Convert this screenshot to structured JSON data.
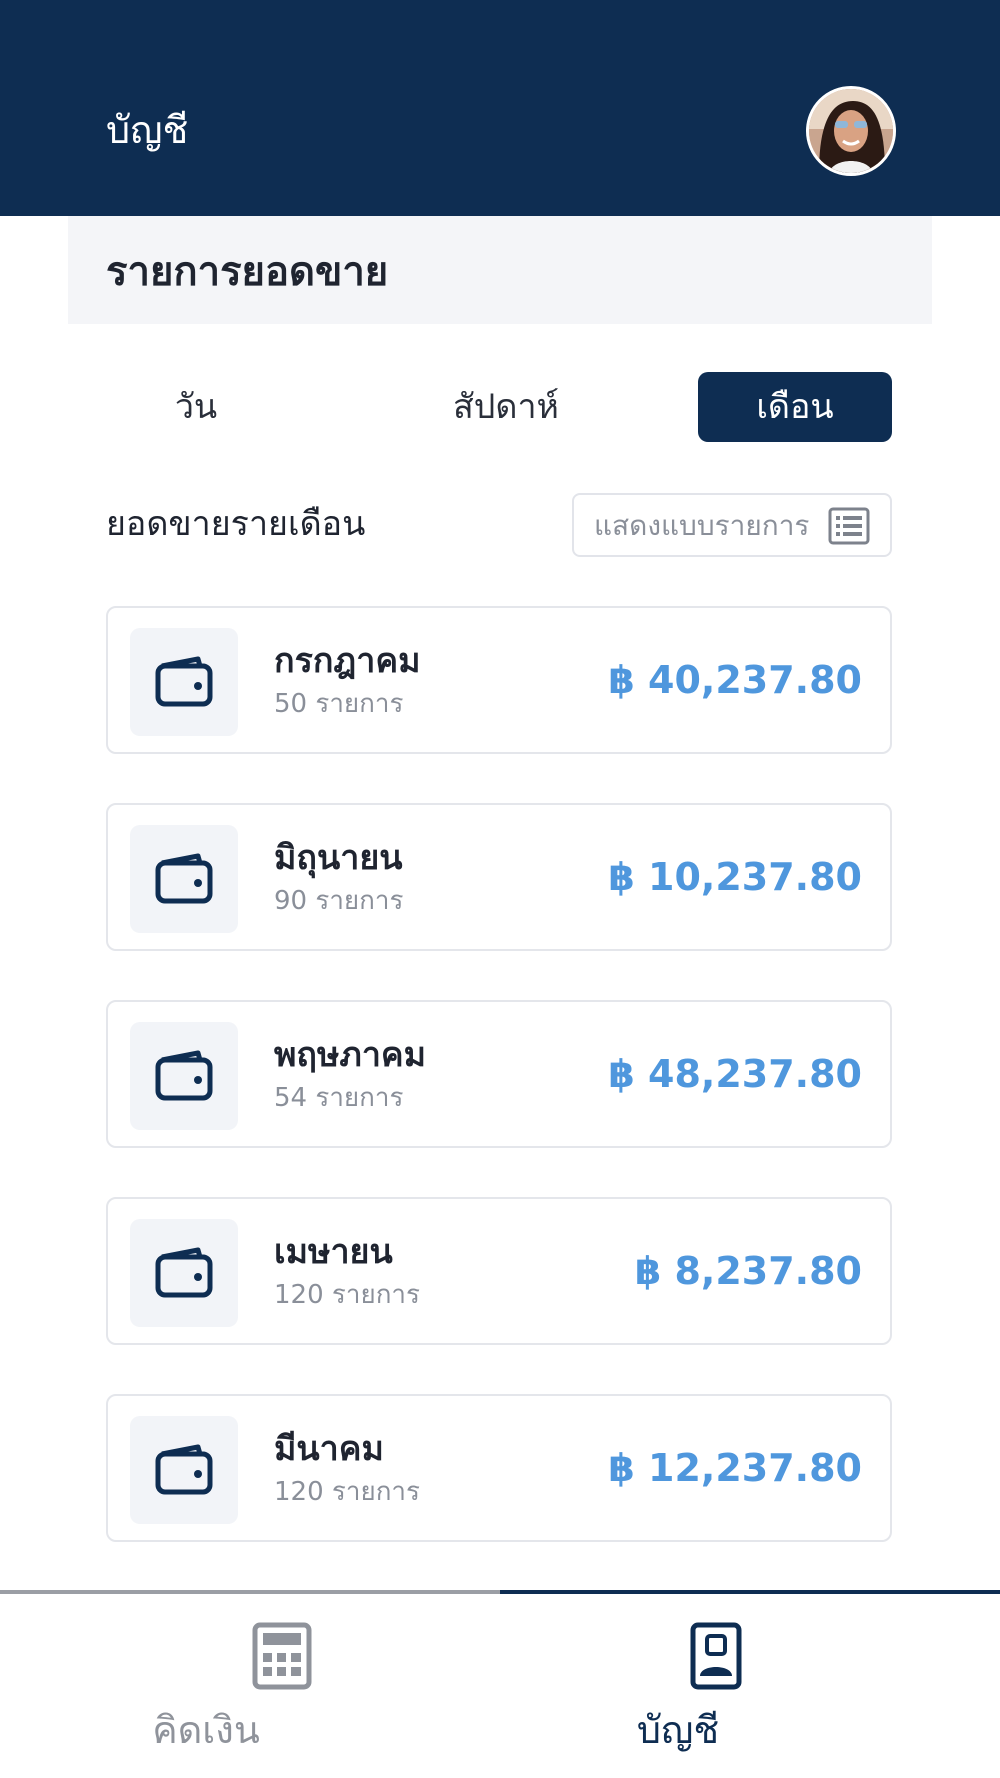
{
  "header": {
    "title": "บัญชี"
  },
  "section": {
    "title": "รายการยอดขาย"
  },
  "tabs": [
    {
      "label": "วัน",
      "active": false
    },
    {
      "label": "สัปดาห์",
      "active": false
    },
    {
      "label": "เดือน",
      "active": true
    }
  ],
  "summary": {
    "label": "ยอดขายรายเดือน",
    "view_toggle_label": "แสดงแบบรายการ"
  },
  "months": [
    {
      "name": "กรกฎาคม",
      "count": "50 รายการ",
      "amount": "฿ 40,237.80"
    },
    {
      "name": "มิถุนายน",
      "count": "90 รายการ",
      "amount": "฿ 10,237.80"
    },
    {
      "name": "พฤษภาคม",
      "count": "54 รายการ",
      "amount": "฿ 48,237.80"
    },
    {
      "name": "เมษายน",
      "count": "120 รายการ",
      "amount": "฿ 8,237.80"
    },
    {
      "name": "มีนาคม",
      "count": "120 รายการ",
      "amount": "฿ 12,237.80"
    }
  ],
  "bottom_nav": [
    {
      "label": "คิดเงิน",
      "icon": "calculator-icon",
      "active": false
    },
    {
      "label": "บัญชี",
      "icon": "id-card-icon",
      "active": true
    }
  ],
  "colors": {
    "primary": "#0e2d52",
    "amount": "#4f97dd",
    "muted": "#8a8f99"
  }
}
